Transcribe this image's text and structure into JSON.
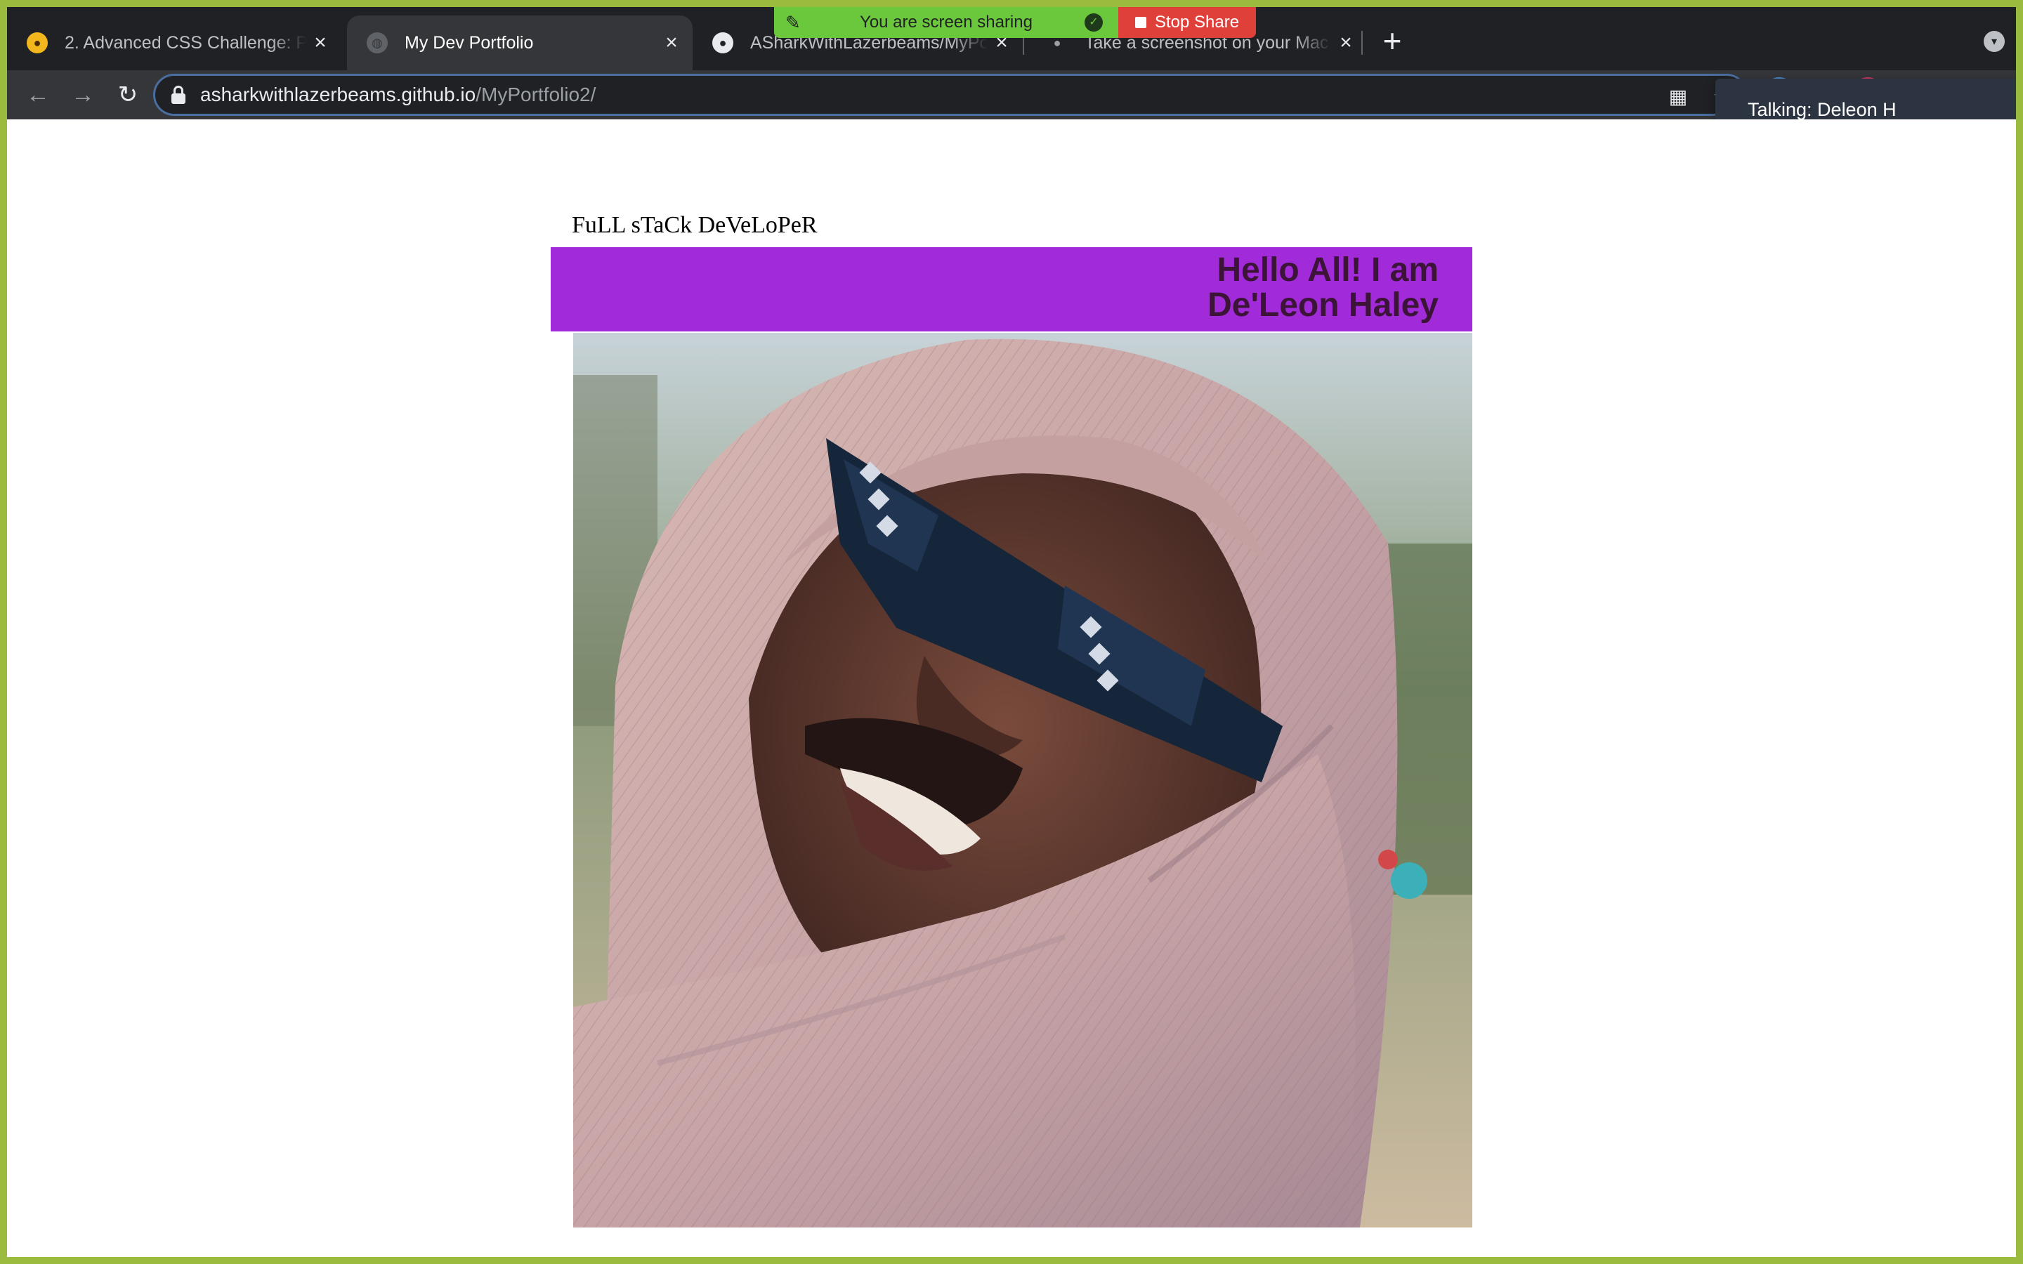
{
  "browser": {
    "tabs": [
      {
        "title": "2. Advanced CSS Challenge: P",
        "active": false,
        "favicon": "udemy-favicon-icon"
      },
      {
        "title": "My Dev Portfolio",
        "active": true,
        "favicon": "globe-icon"
      },
      {
        "title": "ASharkWithLazerbeams/MyPo",
        "active": false,
        "favicon": "github-icon"
      },
      {
        "title": "Take a screenshot on your Mac",
        "active": false,
        "favicon": "apple-icon"
      }
    ],
    "new_tab_label": "+",
    "url_host": "asharkwithlazerbeams.github.io",
    "url_path": "/MyPortfolio2/"
  },
  "screen_share": {
    "status": "You are screen sharing",
    "stop_label": "Stop Share",
    "talking": "Talking: Deleon H"
  },
  "page": {
    "subtitle": "FuLL sTaCk DeVeLoPeR",
    "heading_line1": "Hello All! I am",
    "heading_line2": "De'Leon Haley"
  },
  "colors": {
    "banner": "#a12ad9",
    "heading_text": "#3b1438",
    "window_border": "#9bbb3f",
    "share_green": "#6bc83c",
    "share_red": "#e0403a"
  }
}
